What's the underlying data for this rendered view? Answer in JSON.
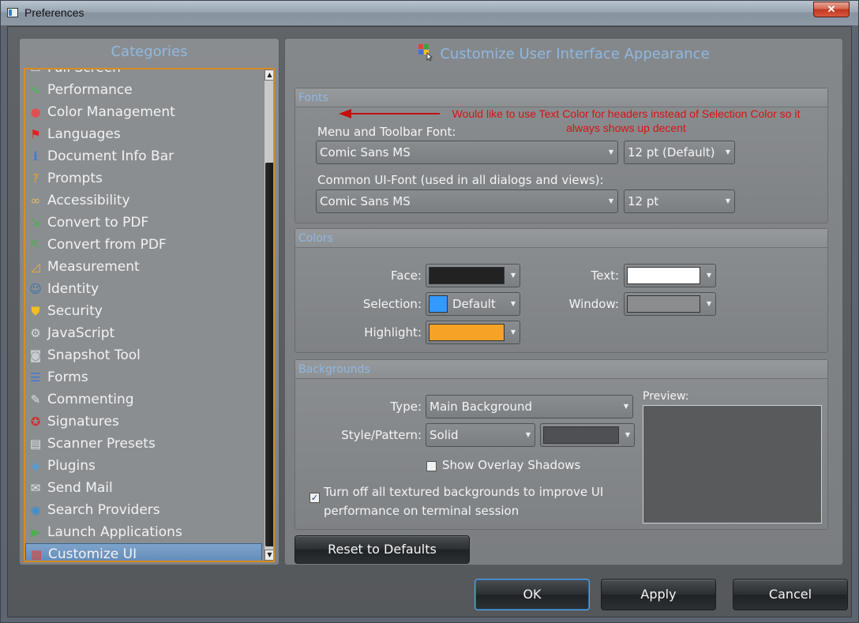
{
  "window": {
    "title": "Preferences",
    "close_label": "✕"
  },
  "categories": {
    "header": "Categories",
    "items": [
      {
        "label": "Full Screen",
        "icon": "full-screen-icon",
        "glyph": "▭",
        "color": "#d0d4d8"
      },
      {
        "label": "Performance",
        "icon": "performance-icon",
        "glyph": "∿",
        "color": "#3fbf3f"
      },
      {
        "label": "Color Management",
        "icon": "color-wheel-icon",
        "glyph": "●",
        "color": "#e05050"
      },
      {
        "label": "Languages",
        "icon": "languages-flag-icon",
        "glyph": "⚑",
        "color": "#e02020"
      },
      {
        "label": "Document Info Bar",
        "icon": "info-icon",
        "glyph": "ℹ",
        "color": "#3a7bd5"
      },
      {
        "label": "Prompts",
        "icon": "question-icon",
        "glyph": "?",
        "color": "#f0a020"
      },
      {
        "label": "Accessibility",
        "icon": "glasses-icon",
        "glyph": "∞",
        "color": "#e0c060"
      },
      {
        "label": "Convert to PDF",
        "icon": "convert-to-pdf-icon",
        "glyph": "⇲",
        "color": "#4caf50"
      },
      {
        "label": "Convert from PDF",
        "icon": "convert-from-pdf-icon",
        "glyph": "⇱",
        "color": "#4caf50"
      },
      {
        "label": "Measurement",
        "icon": "ruler-icon",
        "glyph": "◿",
        "color": "#f0b030"
      },
      {
        "label": "Identity",
        "icon": "user-icon",
        "glyph": "☺",
        "color": "#2f6fc0"
      },
      {
        "label": "Security",
        "icon": "shield-icon",
        "glyph": "⛊",
        "color": "#f0c020"
      },
      {
        "label": "JavaScript",
        "icon": "javascript-icon",
        "glyph": "⚙",
        "color": "#d8dde2"
      },
      {
        "label": "Snapshot Tool",
        "icon": "camera-icon",
        "glyph": "◙",
        "color": "#c8ccd0"
      },
      {
        "label": "Forms",
        "icon": "forms-icon",
        "glyph": "☰",
        "color": "#3a7bd5"
      },
      {
        "label": "Commenting",
        "icon": "comment-icon",
        "glyph": "✎",
        "color": "#e0e0e0"
      },
      {
        "label": "Signatures",
        "icon": "signature-ribbon-icon",
        "glyph": "✪",
        "color": "#d03030"
      },
      {
        "label": "Scanner Presets",
        "icon": "scanner-icon",
        "glyph": "▤",
        "color": "#e0e0e0"
      },
      {
        "label": "Plugins",
        "icon": "plugin-cube-icon",
        "glyph": "◈",
        "color": "#4aa0e0"
      },
      {
        "label": "Send Mail",
        "icon": "mail-icon",
        "glyph": "✉",
        "color": "#e8e8e8"
      },
      {
        "label": "Search Providers",
        "icon": "globe-icon",
        "glyph": "◉",
        "color": "#3a8fd0"
      },
      {
        "label": "Launch Applications",
        "icon": "launch-icon",
        "glyph": "▶",
        "color": "#4caf50"
      },
      {
        "label": "Customize UI",
        "icon": "customize-ui-icon",
        "glyph": "▦",
        "color": "#e04040"
      }
    ]
  },
  "main": {
    "header": "Customize User Interface Appearance",
    "annotation": "Would like to use Text Color for headers instead of Selection Color so it always shows up decent",
    "fonts": {
      "title": "Fonts",
      "menu_font_label": "Menu and Toolbar Font:",
      "menu_font_value": "Comic Sans MS",
      "menu_size_value": "12 pt (Default)",
      "ui_font_label": "Common UI-Font (used in all dialogs and views):",
      "ui_font_value": "Comic Sans MS",
      "ui_size_value": "12 pt"
    },
    "colors": {
      "title": "Colors",
      "face_label": "Face:",
      "face_color": "#222222",
      "text_label": "Text:",
      "text_color": "#ffffff",
      "selection_label": "Selection:",
      "selection_color": "#3399ff",
      "selection_value": "Default",
      "window_label": "Window:",
      "window_color": "#8a8c8e",
      "highlight_label": "Highlight:",
      "highlight_color": "#f5a227"
    },
    "backgrounds": {
      "title": "Backgrounds",
      "type_label": "Type:",
      "type_value": "Main Background",
      "style_label": "Style/Pattern:",
      "style_value": "Solid",
      "pattern_color": "#4e5053",
      "preview_label": "Preview:",
      "overlay_label": "Show Overlay Shadows",
      "overlay_checked": false,
      "textured_label_1": "Turn off all textured backgrounds to improve UI",
      "textured_label_2": "performance on terminal session",
      "textured_checked": true
    },
    "reset_label": "Reset to Defaults"
  },
  "footer": {
    "ok_label": "OK",
    "apply_label": "Apply",
    "cancel_label": "Cancel"
  }
}
